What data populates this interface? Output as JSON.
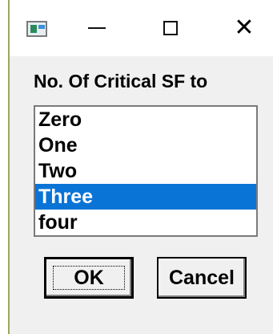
{
  "window": {
    "icon": "app-window-icon",
    "controls": {
      "minimize": "minimize-icon",
      "maximize": "maximize-icon",
      "close": "close-icon",
      "close_glyph": "✕"
    }
  },
  "prompt_label": "No. Of Critical SF to",
  "list": {
    "items": [
      "Zero",
      "One",
      "Two",
      "Three",
      "four"
    ],
    "selected_index": 3,
    "selected_color": "#0a74d6"
  },
  "buttons": {
    "ok_label": "OK",
    "cancel_label": "Cancel"
  }
}
